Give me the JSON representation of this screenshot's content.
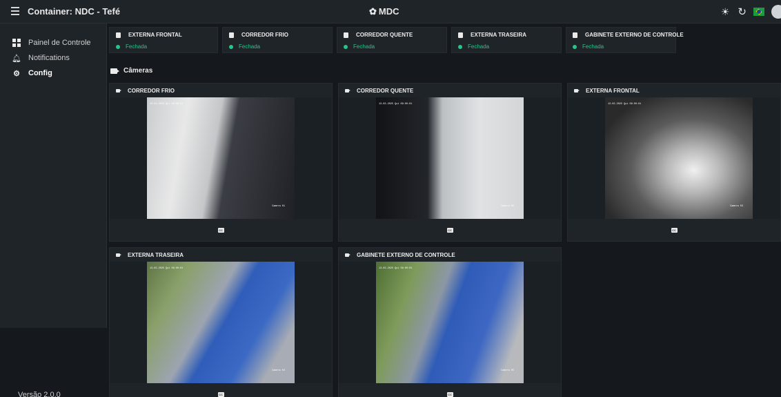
{
  "header": {
    "title": "Container: NDC - Tefé",
    "brand": "MDC"
  },
  "sidebar": {
    "items": [
      {
        "label": "Painel de Controle",
        "icon": "dashboard-grid-icon"
      },
      {
        "label": "Notifications",
        "icon": "bell-icon"
      },
      {
        "label": "Config",
        "icon": "gear-icon",
        "active": true
      }
    ],
    "version": "Versão 2.0.0"
  },
  "sensors": [
    {
      "name": "EXTERNA FRONTAL",
      "status": "Fechada"
    },
    {
      "name": "CORREDOR FRIO",
      "status": "Fechada"
    },
    {
      "name": "CORREDOR QUENTE",
      "status": "Fechada"
    },
    {
      "name": "EXTERNA TRASEIRA",
      "status": "Fechada"
    },
    {
      "name": "GABINETE EXTERNO DE CONTROLE",
      "status": "Fechada"
    }
  ],
  "cameras_section": {
    "title": "Câmeras"
  },
  "cameras": [
    {
      "name": "CORREDOR FRIO",
      "timestamp": "13-02-2025 Qui 09:00:01",
      "overlay": "Camera 01"
    },
    {
      "name": "CORREDOR QUENTE",
      "timestamp": "13-02-2025 Qui 09:00:01",
      "overlay": "Camera 02"
    },
    {
      "name": "EXTERNA FRONTAL",
      "timestamp": "13-02-2025 Qui 09:00:01",
      "overlay": "Camera 03"
    },
    {
      "name": "EXTERNA TRASEIRA",
      "timestamp": "13-02-2025 Qui 09:00:01",
      "overlay": "Camera 04"
    },
    {
      "name": "GABINETE EXTERNO DE CONTROLE",
      "timestamp": "13-02-2025 Qui 09:00:01",
      "overlay": "Camera 05"
    }
  ],
  "colors": {
    "status_ok": "#27c48a",
    "panel": "#1f2429",
    "background": "#15191e"
  }
}
